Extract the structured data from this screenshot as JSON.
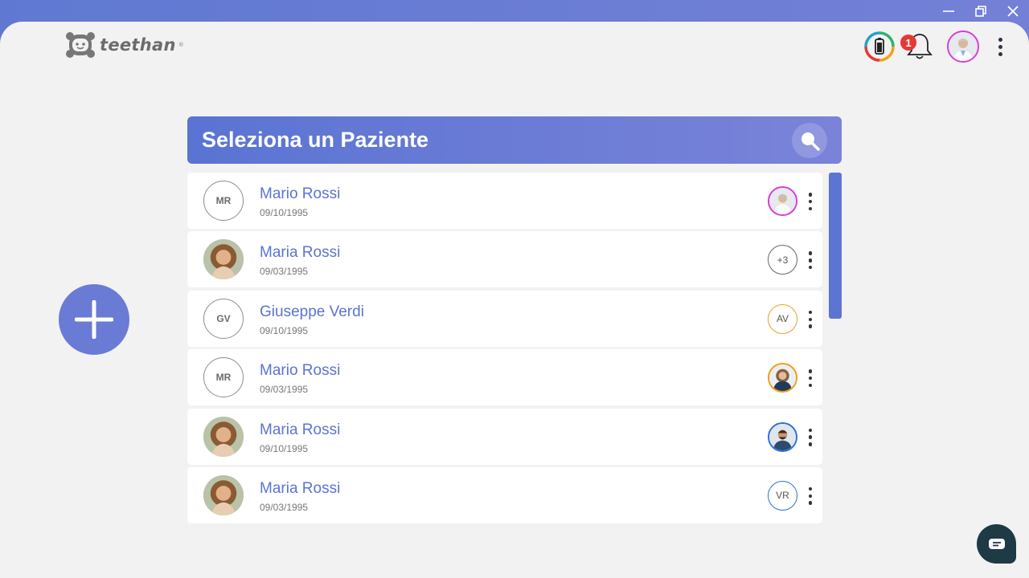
{
  "window": {
    "minimize_icon": "minimize-icon",
    "restore_icon": "restore-icon",
    "close_icon": "close-icon"
  },
  "header": {
    "logo_text": "teethan",
    "logo_reg": "®",
    "notifications_count": "1"
  },
  "panel": {
    "title": "Seleziona un Paziente"
  },
  "colors": {
    "accent": "#5b74cf",
    "chat": "#1d3a45",
    "badge": "#e53935"
  },
  "patients": [
    {
      "initials": "MR",
      "name": "Mario Rossi",
      "date": "09/10/1995",
      "avatar_type": "initials",
      "doctor": {
        "type": "photo",
        "label": "",
        "border": "#d63cd6"
      }
    },
    {
      "initials": "",
      "name": "Maria Rossi",
      "date": "09/03/1995",
      "avatar_type": "photo",
      "doctor": {
        "type": "text",
        "label": "+3",
        "border": "#666666"
      }
    },
    {
      "initials": "GV",
      "name": "Giuseppe Verdi",
      "date": "09/10/1995",
      "avatar_type": "initials",
      "doctor": {
        "type": "text",
        "label": "AV",
        "border": "#f29b1d"
      }
    },
    {
      "initials": "MR",
      "name": "Mario Rossi",
      "date": "09/03/1995",
      "avatar_type": "initials",
      "doctor": {
        "type": "photo",
        "label": "",
        "border": "#f29b1d"
      }
    },
    {
      "initials": "",
      "name": "Maria Rossi",
      "date": "09/10/1995",
      "avatar_type": "photo",
      "doctor": {
        "type": "photo",
        "label": "",
        "border": "#2f6fd6"
      }
    },
    {
      "initials": "",
      "name": "Maria Rossi",
      "date": "09/03/1995",
      "avatar_type": "photo",
      "doctor": {
        "type": "text",
        "label": "VR",
        "border": "#2f6fd6"
      }
    }
  ]
}
